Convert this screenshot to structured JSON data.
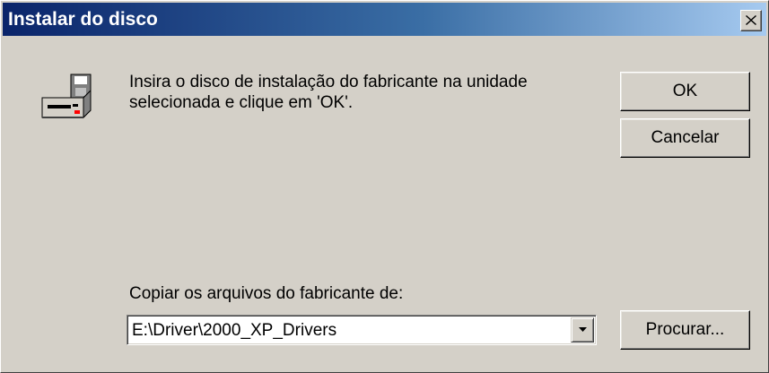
{
  "window": {
    "title": "Instalar do disco"
  },
  "icons": {
    "title_close": "close-icon",
    "message": "disk-drive-icon",
    "combo_arrow": "chevron-down-icon"
  },
  "colors": {
    "titlebar_start": "#0a246a",
    "titlebar_end": "#a6caf0",
    "face": "#d4d0c8"
  },
  "message": {
    "line1": "Insira o disco de instalação do fabricante na unidade",
    "line2": "selecionada e clique em 'OK'."
  },
  "buttons": {
    "ok": "OK",
    "cancel": "Cancelar",
    "browse": "Procurar..."
  },
  "copy_from": {
    "label": "Copiar os arquivos do fabricante de:",
    "value": "E:\\Driver\\2000_XP_Drivers"
  }
}
